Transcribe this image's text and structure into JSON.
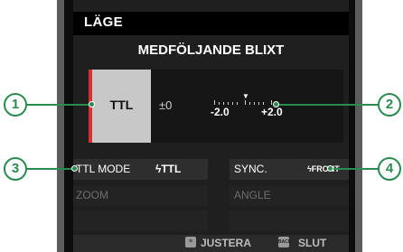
{
  "header": {
    "title": "LÄGE"
  },
  "section": {
    "title": "MEDFÖLJANDE BLIXT"
  },
  "mode": {
    "label": "TTL",
    "ev": "±0"
  },
  "scale": {
    "min": "-2.0",
    "max": "+2.0"
  },
  "settings": {
    "ttl_mode_label": "TTL MODE",
    "ttl_mode_value": "ϟTTL",
    "zoom_label": "ZOOM",
    "sync_label": "SYNC.",
    "sync_value": "ϟFRONT",
    "angle_label": "ANGLE"
  },
  "footer": {
    "adjust": "JUSTERA",
    "back_icon_text": "BACK",
    "exit": "SLUT"
  },
  "callouts": [
    "1",
    "2",
    "3",
    "4"
  ],
  "colors": {
    "accent": "#2a8a4f",
    "selected_marker": "#d83131"
  }
}
